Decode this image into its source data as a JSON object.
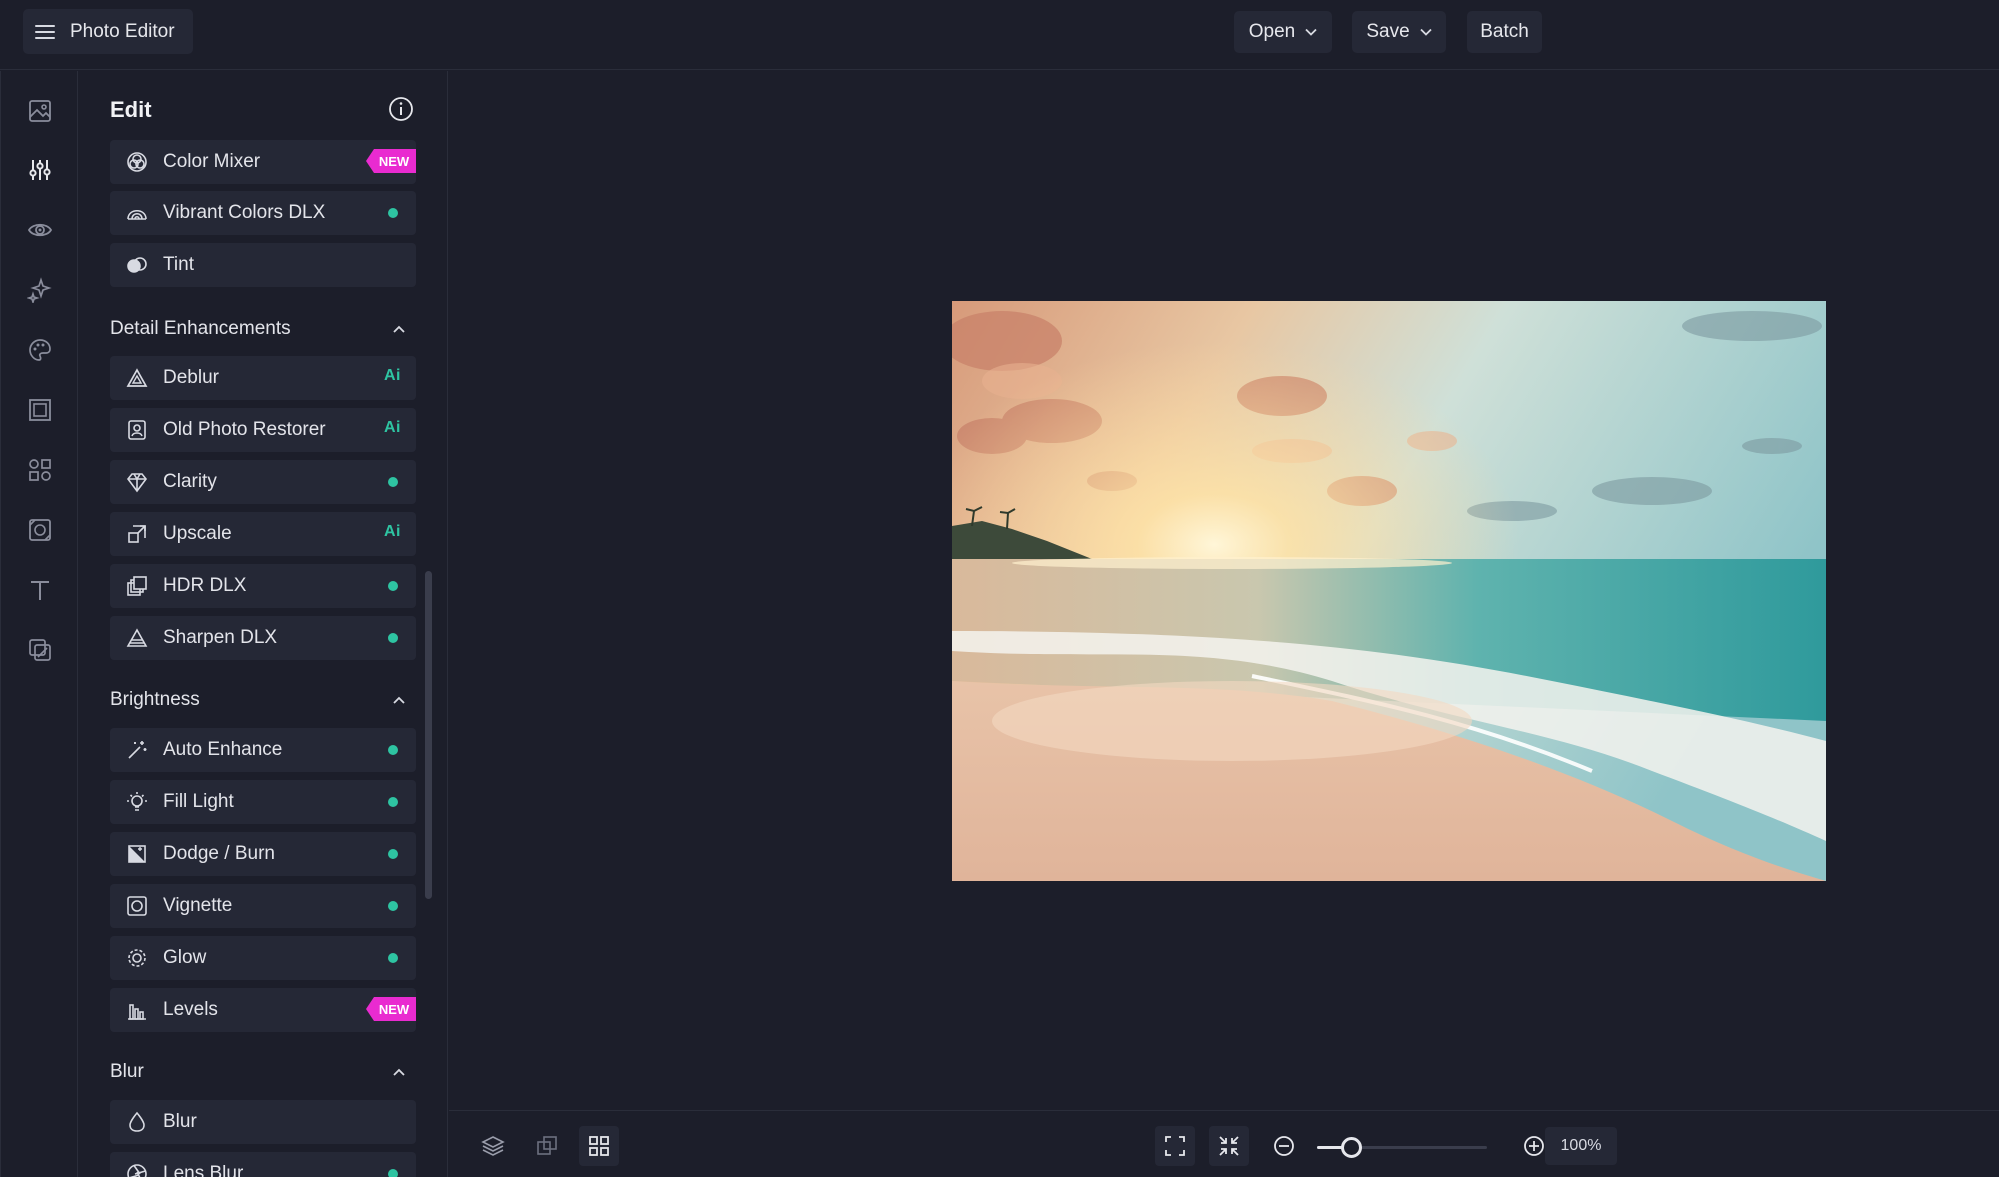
{
  "app": {
    "title": "Photo Editor"
  },
  "topbar": {
    "open_label": "Open",
    "save_label": "Save",
    "batch_label": "Batch"
  },
  "rail": {
    "items": [
      "image-icon",
      "adjust-sliders-icon",
      "eye-icon",
      "sparkles-icon",
      "palette-icon",
      "frame-icon",
      "shapes-icon",
      "texture-icon",
      "text-icon",
      "layers-overlay-icon"
    ],
    "active": "adjust-sliders-icon"
  },
  "panel": {
    "title": "Edit",
    "top_tools": [
      {
        "label": "Color Mixer",
        "badge": "NEW"
      },
      {
        "label": "Vibrant Colors DLX",
        "badge": "dot"
      },
      {
        "label": "Tint",
        "badge": ""
      }
    ],
    "sections": [
      {
        "title": "Detail Enhancements",
        "tools": [
          {
            "label": "Deblur",
            "badge": "Ai"
          },
          {
            "label": "Old Photo Restorer",
            "badge": "Ai"
          },
          {
            "label": "Clarity",
            "badge": "dot"
          },
          {
            "label": "Upscale",
            "badge": "Ai"
          },
          {
            "label": "HDR DLX",
            "badge": "dot"
          },
          {
            "label": "Sharpen DLX",
            "badge": "dot"
          }
        ]
      },
      {
        "title": "Brightness",
        "tools": [
          {
            "label": "Auto Enhance",
            "badge": "dot"
          },
          {
            "label": "Fill Light",
            "badge": "dot"
          },
          {
            "label": "Dodge / Burn",
            "badge": "dot"
          },
          {
            "label": "Vignette",
            "badge": "dot"
          },
          {
            "label": "Glow",
            "badge": "dot"
          },
          {
            "label": "Levels",
            "badge": "NEW"
          }
        ]
      },
      {
        "title": "Blur",
        "tools": [
          {
            "label": "Blur",
            "badge": ""
          },
          {
            "label": "Lens Blur",
            "badge": "dot"
          }
        ]
      }
    ]
  },
  "zoom": {
    "value_label": "100%",
    "slider_fraction": 0.2
  },
  "colors": {
    "accent_dot": "#2ec4a2",
    "new_badge": "#e92bd0",
    "background": "#1c1e2a",
    "panel_item": "#252836"
  }
}
